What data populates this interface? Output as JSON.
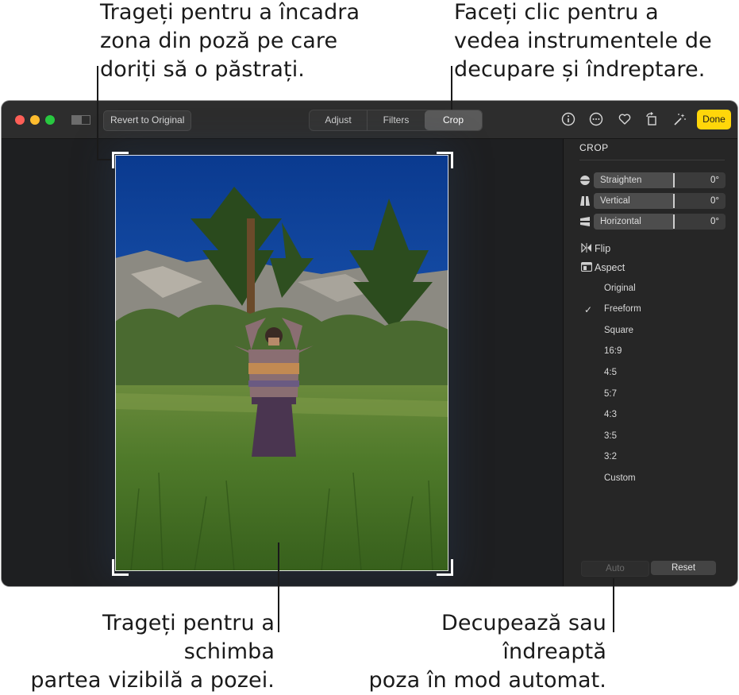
{
  "callouts": {
    "drag_frame": "Trageți pentru a încadra\nzona din poză pe care\ndoriți să o păstrați.",
    "crop_tools": "Faceți clic pentru a\nvedea instrumentele de\ndecupare și îndreptare.",
    "drag_visible": "Trageți pentru a schimba\npartea vizibilă a pozei.",
    "auto": "Decupează sau îndreaptă\npoza în mod automat."
  },
  "toolbar": {
    "revert_label": "Revert to Original",
    "tabs": [
      {
        "label": "Adjust",
        "selected": false
      },
      {
        "label": "Filters",
        "selected": false
      },
      {
        "label": "Crop",
        "selected": true
      }
    ],
    "icons": [
      "info-icon",
      "more-icon",
      "heart-icon",
      "rotate-icon",
      "magic-wand-icon"
    ],
    "done_label": "Done"
  },
  "colors": {
    "done_yellow": "#ffd60a",
    "close": "#ff5f57",
    "minimize": "#febc2e",
    "maximize": "#28c840"
  },
  "panel": {
    "title": "CROP",
    "sliders": [
      {
        "label": "Straighten",
        "value": "0°",
        "icon": "straighten-icon"
      },
      {
        "label": "Vertical",
        "value": "0°",
        "icon": "vertical-perspective-icon"
      },
      {
        "label": "Horizontal",
        "value": "0°",
        "icon": "horizontal-perspective-icon"
      }
    ],
    "flip_label": "Flip",
    "aspect_label": "Aspect",
    "aspect_options": [
      "Original",
      "Freeform",
      "Square",
      "16:9",
      "4:5",
      "5:7",
      "4:3",
      "3:5",
      "3:2",
      "Custom"
    ],
    "selected_aspect": "Freeform",
    "check_glyph": "✓",
    "auto_label": "Auto",
    "reset_label": "Reset"
  }
}
